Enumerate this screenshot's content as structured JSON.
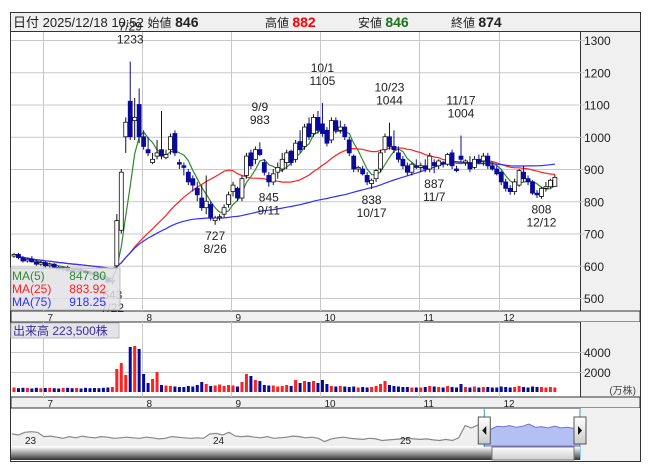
{
  "header": {
    "date_label": "日付",
    "datetime": "2025/12/18 10:52",
    "open_label": "始値",
    "open": "846",
    "high_label": "高値",
    "high": "882",
    "low_label": "安値",
    "low": "846",
    "close_label": "終値",
    "close": "874"
  },
  "colors": {
    "up_vol": "#ff2020",
    "down_vol": "#0a0a9a",
    "down_candle": "#0a0a9a",
    "ma5": "#2e8b2e",
    "ma25": "#ff2020",
    "ma75": "#3030ff",
    "high": "#ff0000",
    "low": "#207020"
  },
  "legend": [
    {
      "label": "MA(5)",
      "value": "847.80"
    },
    {
      "label": "MA(25)",
      "value": "883.92"
    },
    {
      "label": "MA(75)",
      "value": "918.25"
    }
  ],
  "volume_label": {
    "title": "出来高",
    "value": "223,500株"
  },
  "navigator": {
    "year_labels": [
      "23",
      "24",
      "25"
    ],
    "values": [
      52,
      50,
      55,
      56,
      55,
      47,
      48,
      46,
      44,
      47,
      45,
      48,
      46,
      45,
      47,
      46,
      44,
      45,
      46,
      45,
      44,
      46,
      45,
      43,
      44,
      47,
      46,
      45,
      44,
      45,
      44,
      52,
      53,
      50,
      55,
      48,
      47,
      48,
      46,
      45,
      47,
      44,
      45,
      46,
      48,
      47,
      45,
      46,
      44,
      38,
      43,
      45,
      46,
      44,
      43,
      42,
      44,
      43,
      40,
      41,
      42,
      43,
      44,
      43,
      42,
      43,
      41,
      40,
      42,
      40,
      45,
      67,
      63,
      68,
      62,
      60,
      66,
      65,
      67,
      64,
      66,
      70,
      64,
      65,
      63,
      66,
      63,
      64,
      62,
      65
    ]
  },
  "chart_data": {
    "type": "candlestick",
    "title": "",
    "y_axis_ticks": [
      500,
      600,
      700,
      800,
      900,
      1000,
      1100,
      1200,
      1300
    ],
    "ylim": [
      470,
      1330
    ],
    "volume_axis_ticks": [
      "4000",
      "2000"
    ],
    "volume_unit": "(万株)",
    "volume_ylim": [
      0,
      4000
    ],
    "months": [
      {
        "label": "7",
        "index": 7
      },
      {
        "label": "8",
        "index": 29
      },
      {
        "label": "9",
        "index": 49
      },
      {
        "label": "10",
        "index": 69
      },
      {
        "label": "11",
        "index": 91
      },
      {
        "label": "12",
        "index": 109
      }
    ],
    "ohlc": [
      [
        630,
        640,
        625,
        635
      ],
      [
        635,
        640,
        620,
        625
      ],
      [
        625,
        630,
        610,
        615
      ],
      [
        615,
        625,
        610,
        620
      ],
      [
        620,
        630,
        610,
        612
      ],
      [
        612,
        620,
        600,
        605
      ],
      [
        605,
        615,
        600,
        610
      ],
      [
        610,
        615,
        595,
        600
      ],
      [
        600,
        610,
        595,
        605
      ],
      [
        605,
        608,
        590,
        595
      ],
      [
        595,
        600,
        585,
        590
      ],
      [
        590,
        598,
        585,
        595
      ],
      [
        595,
        600,
        580,
        585
      ],
      [
        585,
        590,
        578,
        582
      ],
      [
        582,
        590,
        575,
        588
      ],
      [
        588,
        592,
        580,
        584
      ],
      [
        584,
        588,
        575,
        578
      ],
      [
        578,
        585,
        570,
        575
      ],
      [
        575,
        580,
        565,
        570
      ],
      [
        570,
        575,
        560,
        565
      ],
      [
        565,
        570,
        555,
        560
      ],
      [
        560,
        562,
        545,
        550
      ],
      [
        550,
        560,
        543,
        555
      ],
      [
        600,
        760,
        595,
        740
      ],
      [
        710,
        900,
        700,
        890
      ],
      [
        1000,
        1060,
        950,
        1045
      ],
      [
        1110,
        1233,
        990,
        1000
      ],
      [
        1050,
        1120,
        990,
        1060
      ],
      [
        1100,
        1150,
        980,
        1000
      ],
      [
        1000,
        1020,
        960,
        970
      ],
      [
        960,
        1000,
        940,
        950
      ],
      [
        920,
        950,
        915,
        930
      ],
      [
        940,
        990,
        930,
        950
      ],
      [
        960,
        1080,
        930,
        940
      ],
      [
        935,
        960,
        930,
        945
      ],
      [
        960,
        1010,
        945,
        1000
      ],
      [
        1010,
        1020,
        940,
        950
      ],
      [
        920,
        930,
        900,
        915
      ],
      [
        910,
        920,
        880,
        905
      ],
      [
        890,
        900,
        850,
        860
      ],
      [
        870,
        880,
        830,
        850
      ],
      [
        840,
        860,
        800,
        820
      ],
      [
        810,
        850,
        770,
        780
      ],
      [
        780,
        880,
        760,
        800
      ],
      [
        790,
        800,
        740,
        750
      ],
      [
        740,
        755,
        727,
        748
      ],
      [
        750,
        760,
        740,
        752
      ],
      [
        760,
        790,
        750,
        780
      ],
      [
        790,
        830,
        780,
        820
      ],
      [
        830,
        860,
        815,
        850
      ],
      [
        840,
        845,
        800,
        810
      ],
      [
        810,
        880,
        800,
        870
      ],
      [
        880,
        950,
        870,
        940
      ],
      [
        950,
        960,
        900,
        910
      ],
      [
        930,
        970,
        915,
        960
      ],
      [
        960,
        983,
        940,
        945
      ],
      [
        920,
        930,
        880,
        890
      ],
      [
        880,
        890,
        845,
        860
      ],
      [
        860,
        900,
        850,
        885
      ],
      [
        890,
        920,
        870,
        905
      ],
      [
        900,
        950,
        890,
        930
      ],
      [
        920,
        960,
        900,
        950
      ],
      [
        955,
        960,
        910,
        920
      ],
      [
        930,
        990,
        920,
        980
      ],
      [
        985,
        1020,
        950,
        960
      ],
      [
        970,
        1040,
        960,
        1030
      ],
      [
        1040,
        1060,
        990,
        1000
      ],
      [
        1010,
        1070,
        1000,
        1060
      ],
      [
        1060,
        1080,
        1010,
        1020
      ],
      [
        1040,
        1105,
        1000,
        1010
      ],
      [
        1020,
        1030,
        970,
        980
      ],
      [
        990,
        1060,
        980,
        1050
      ],
      [
        1050,
        1060,
        1010,
        1020
      ],
      [
        1020,
        1050,
        1010,
        1030
      ],
      [
        1030,
        1040,
        990,
        1000
      ],
      [
        990,
        1000,
        940,
        950
      ],
      [
        940,
        945,
        890,
        900
      ],
      [
        900,
        910,
        890,
        905
      ],
      [
        900,
        910,
        880,
        885
      ],
      [
        880,
        890,
        850,
        860
      ],
      [
        855,
        870,
        838,
        865
      ],
      [
        870,
        900,
        860,
        895
      ],
      [
        900,
        960,
        890,
        950
      ],
      [
        960,
        1010,
        950,
        1000
      ],
      [
        1000,
        1044,
        960,
        970
      ],
      [
        970,
        1020,
        950,
        960
      ],
      [
        950,
        970,
        920,
        930
      ],
      [
        930,
        940,
        900,
        910
      ],
      [
        910,
        920,
        880,
        890
      ],
      [
        890,
        920,
        880,
        915
      ],
      [
        910,
        930,
        900,
        905
      ],
      [
        905,
        920,
        890,
        910
      ],
      [
        910,
        930,
        890,
        900
      ],
      [
        900,
        950,
        890,
        940
      ],
      [
        920,
        930,
        887,
        910
      ],
      [
        910,
        930,
        900,
        925
      ],
      [
        920,
        925,
        905,
        915
      ],
      [
        915,
        950,
        910,
        945
      ],
      [
        950,
        960,
        900,
        910
      ],
      [
        900,
        910,
        890,
        895
      ],
      [
        940,
        1004,
        920,
        930
      ],
      [
        920,
        930,
        910,
        925
      ],
      [
        920,
        940,
        890,
        900
      ],
      [
        905,
        940,
        900,
        930
      ],
      [
        930,
        945,
        915,
        920
      ],
      [
        925,
        950,
        910,
        940
      ],
      [
        940,
        950,
        900,
        910
      ],
      [
        910,
        920,
        895,
        900
      ],
      [
        900,
        910,
        880,
        885
      ],
      [
        890,
        895,
        850,
        860
      ],
      [
        860,
        870,
        830,
        840
      ],
      [
        840,
        850,
        820,
        830
      ],
      [
        830,
        870,
        820,
        860
      ],
      [
        850,
        900,
        845,
        895
      ],
      [
        890,
        910,
        860,
        870
      ],
      [
        870,
        880,
        850,
        860
      ],
      [
        860,
        865,
        820,
        825
      ],
      [
        825,
        835,
        810,
        820
      ],
      [
        815,
        845,
        808,
        840
      ],
      [
        840,
        860,
        830,
        845
      ],
      [
        845,
        870,
        840,
        865
      ],
      [
        846,
        882,
        846,
        874
      ]
    ],
    "volume": [
      450,
      380,
      420,
      400,
      350,
      420,
      380,
      400,
      420,
      380,
      350,
      400,
      420,
      380,
      400,
      350,
      420,
      380,
      400,
      380,
      420,
      450,
      500,
      2300,
      2900,
      1700,
      4500,
      4600,
      4300,
      1800,
      900,
      1300,
      2000,
      700,
      650,
      600,
      550,
      500,
      500,
      600,
      550,
      700,
      1000,
      800,
      600,
      650,
      750,
      600,
      700,
      650,
      550,
      1000,
      1800,
      1600,
      1200,
      1100,
      700,
      650,
      650,
      550,
      600,
      700,
      600,
      1200,
      900,
      1100,
      1000,
      1100,
      900,
      1200,
      800,
      600,
      550,
      600,
      550,
      500,
      550,
      450,
      500,
      450,
      500,
      600,
      800,
      1100,
      700,
      600,
      550,
      500,
      500,
      450,
      450,
      450,
      500,
      600,
      550,
      500,
      450,
      600,
      500,
      450,
      800,
      500,
      450,
      550,
      450,
      500,
      500,
      450,
      450,
      550,
      500,
      450,
      500,
      600,
      500,
      450,
      550,
      500,
      500,
      450,
      500,
      450
    ],
    "annotations": [
      {
        "index": 26,
        "date": "7/29",
        "price": "1233",
        "pos": "above"
      },
      {
        "index": 45,
        "date": "8/26",
        "price": "727",
        "pos": "below"
      },
      {
        "index": 55,
        "date": "9/9",
        "price": "983",
        "pos": "above"
      },
      {
        "index": 57,
        "date": "9/11",
        "price": "845",
        "pos": "below"
      },
      {
        "index": 69,
        "date": "10/1",
        "price": "1105",
        "pos": "above"
      },
      {
        "index": 80,
        "date": "10/17",
        "price": "838",
        "pos": "below"
      },
      {
        "index": 84,
        "date": "10/23",
        "price": "1044",
        "pos": "above"
      },
      {
        "index": 94,
        "date": "11/7",
        "price": "887",
        "pos": "below"
      },
      {
        "index": 100,
        "date": "11/17",
        "price": "1004",
        "pos": "above"
      },
      {
        "index": 118,
        "date": "12/12",
        "price": "808",
        "pos": "below"
      },
      {
        "index": 22,
        "date": "7/22",
        "price": "543",
        "pos": "below"
      }
    ],
    "moving_averages": [
      5,
      25,
      75
    ]
  }
}
